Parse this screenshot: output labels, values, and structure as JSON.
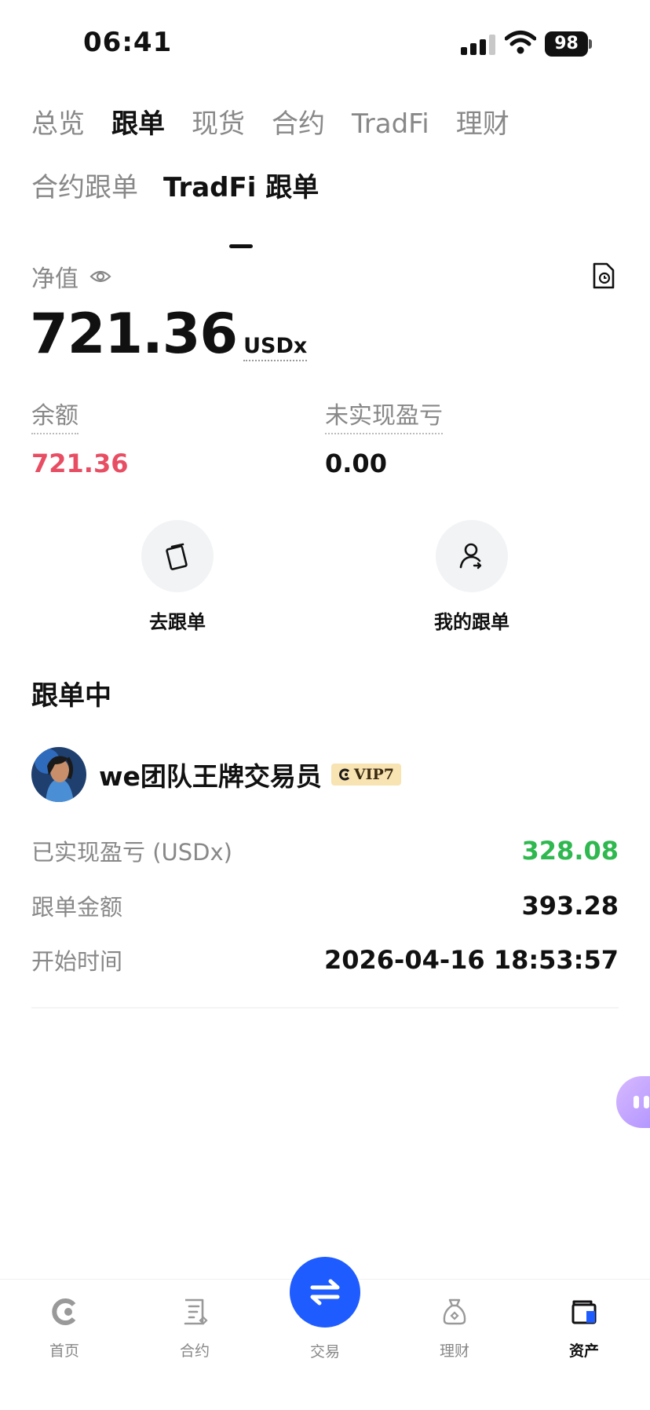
{
  "status_bar": {
    "time": "06:41",
    "battery": "98"
  },
  "top_tabs": [
    {
      "label": "总览",
      "active": false
    },
    {
      "label": "跟单",
      "active": true
    },
    {
      "label": "现货",
      "active": false
    },
    {
      "label": "合约",
      "active": false
    },
    {
      "label": "TradFi",
      "active": false
    },
    {
      "label": "理财",
      "active": false
    }
  ],
  "sub_tabs": [
    {
      "label": "合约跟单",
      "active": false
    },
    {
      "label": "TradFi 跟单",
      "active": true
    }
  ],
  "net_value": {
    "label": "净值",
    "amount": "721.36",
    "unit": "USDx"
  },
  "stats": {
    "balance_label": "余额",
    "balance_value": "721.36",
    "upnl_label": "未实现盈亏",
    "upnl_value": "0.00"
  },
  "actions": {
    "follow_label": "去跟单",
    "my_label": "我的跟单"
  },
  "section_title": "跟单中",
  "trader": {
    "name": "we团队王牌交易员",
    "vip": "VIP7",
    "realized_label": "已实现盈亏 (USDx)",
    "realized_value": "328.08",
    "amount_label": "跟单金额",
    "amount_value": "393.28",
    "start_label": "开始时间",
    "start_value": "2026-04-16 18:53:57"
  },
  "tabbar": {
    "home": "首页",
    "contract": "合约",
    "trade": "交易",
    "finance": "理财",
    "assets": "资产",
    "active": "assets"
  },
  "colors": {
    "balance_red": "#e84e63",
    "profit_green": "#2fb84f",
    "trade_blue": "#1f5cff",
    "vip_gold": "#f8e3b3"
  }
}
